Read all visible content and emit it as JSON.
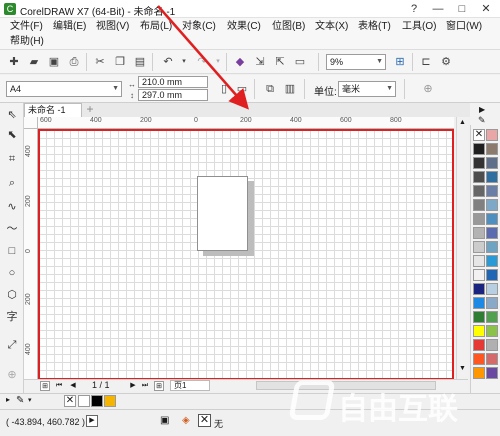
{
  "window": {
    "title": "CorelDRAW X7 (64-Bit) - 未命名 -1",
    "logo_glyph": "C",
    "controls": [
      "?",
      "—",
      "□",
      "✕"
    ]
  },
  "menu": {
    "items": [
      "文件(F)",
      "编辑(E)",
      "视图(V)",
      "布局(L)",
      "对象(C)",
      "效果(C)",
      "位图(B)",
      "文本(X)",
      "表格(T)",
      "工具(O)",
      "窗口(W)",
      "帮助(H)"
    ]
  },
  "toolbar": {
    "zoom_value": "9%"
  },
  "property_bar": {
    "page_size": "A4",
    "width": "210.0 mm",
    "height": "297.0 mm",
    "units_label": "单位:",
    "units_value": "毫米"
  },
  "document": {
    "tab_label": "未命名 -1",
    "add_tab": "+"
  },
  "rulers": {
    "h_labels": [
      "600",
      "400",
      "200",
      "0",
      "200",
      "400",
      "600",
      "800"
    ],
    "v_labels": [
      "400",
      "200",
      "0",
      "200",
      "400"
    ]
  },
  "page_nav": {
    "page_count": "1 / 1",
    "page_tab": "页1"
  },
  "status": {
    "coordinates": "( -43.894, 460.782 )",
    "fill_none": "无"
  },
  "palette": {
    "colors": [
      [
        "#ffffff",
        "#e8a6a6"
      ],
      [
        "#1f1f1f",
        "#8c7a6d"
      ],
      [
        "#333333",
        "#5f6f8a"
      ],
      [
        "#4d4d4d",
        "#2f6e9e"
      ],
      [
        "#666666",
        "#6b7fa6"
      ],
      [
        "#808080",
        "#7ea8c8"
      ],
      [
        "#999999",
        "#4f8fbf"
      ],
      [
        "#b3b3b3",
        "#5a6bb0"
      ],
      [
        "#cccccc",
        "#6ea3c1"
      ],
      [
        "#e6e6e6",
        "#2a9ad6"
      ],
      [
        "#f2f2f2",
        "#1f66b5"
      ],
      [
        "#1a237e",
        "#b7cfe0"
      ],
      [
        "#1e88e5",
        "#8aa9c9"
      ],
      [
        "#2e7d32",
        "#50a050"
      ],
      [
        "#ffff00",
        "#8bc34a"
      ],
      [
        "#e53935",
        "#b0b0b0"
      ],
      [
        "#ff5722",
        "#d46a6a"
      ],
      [
        "#ff9800",
        "#6a4aa0"
      ]
    ]
  },
  "fill_swatches": [
    "#ffffff",
    "#000000",
    "#f4b400"
  ],
  "watermark": {
    "text": "自由互联"
  }
}
